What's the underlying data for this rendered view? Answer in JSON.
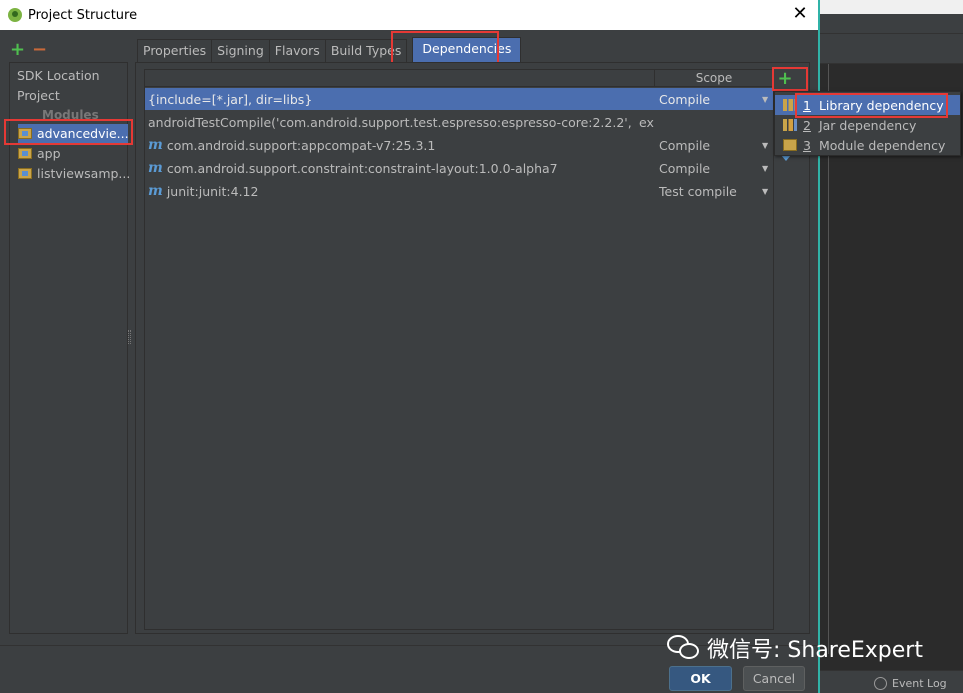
{
  "window": {
    "title": "Project Structure",
    "close_label": "✕"
  },
  "left_tools": {
    "add_label": "+",
    "remove_label": "−"
  },
  "left_nav": {
    "items": [
      "SDK Location",
      "Project"
    ],
    "modules_header": "Modules",
    "modules": [
      "advancedvie...",
      "app",
      "listviewsamp..."
    ],
    "selected_module": "advancedvie..."
  },
  "tabs": [
    "Properties",
    "Signing",
    "Flavors",
    "Build Types",
    "Dependencies"
  ],
  "active_tab": "Dependencies",
  "table": {
    "header_scope": "Scope",
    "rows": [
      {
        "dependency": "{include=[*.jar], dir=libs}",
        "scope": "Compile",
        "has_m_icon": false,
        "selected": true
      },
      {
        "dependency": "androidTestCompile('com.android.support.test.espresso:espresso-core:2.2.2', {",
        "scope": "",
        "trailing": "ex",
        "has_m_icon": false,
        "selected": false
      },
      {
        "dependency": "com.android.support:appcompat-v7:25.3.1",
        "scope": "Compile",
        "has_m_icon": true,
        "selected": false
      },
      {
        "dependency": "com.android.support.constraint:constraint-layout:1.0.0-alpha7",
        "scope": "Compile",
        "has_m_icon": true,
        "selected": false
      },
      {
        "dependency": "junit:junit:4.12",
        "scope": "Test compile",
        "has_m_icon": true,
        "selected": false
      }
    ],
    "m_icon_glyph": "m",
    "dropdown_glyph": "▼"
  },
  "side_tools": {
    "add_label": "+"
  },
  "add_menu": {
    "items": [
      {
        "num": "1",
        "label": "Library dependency",
        "icon": "library-icon"
      },
      {
        "num": "2",
        "label": "Jar dependency",
        "icon": "jar-icon"
      },
      {
        "num": "3",
        "label": "Module dependency",
        "icon": "module-icon"
      }
    ],
    "selected_index": 0
  },
  "watermark": "微信号: ShareExpert",
  "buttons": {
    "ok": "OK",
    "cancel": "Cancel"
  },
  "background_ide": {
    "event_log": "Event Log"
  },
  "colors": {
    "selection": "#4b6eaf",
    "panel_bg": "#3c3f41",
    "highlight_box": "#e53935",
    "add_green": "#4fbf4f",
    "accent_border": "#30b3a8"
  }
}
